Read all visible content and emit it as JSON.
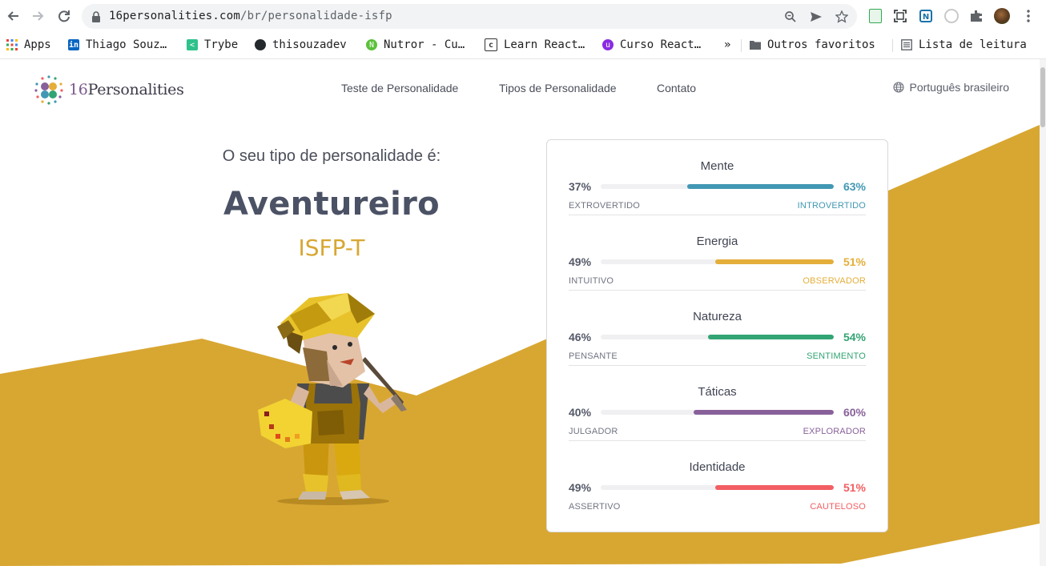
{
  "browser": {
    "url_domain": "16personalities.com",
    "url_path": "/br/personalidade-isfp"
  },
  "bookmarks": [
    {
      "label": "Apps",
      "icon": "apps-grid-icon"
    },
    {
      "label": "Thiago Souz…",
      "icon": "linkedin-icon"
    },
    {
      "label": "Trybe",
      "icon": "trybe-icon"
    },
    {
      "label": "thisouzadev",
      "icon": "github-icon"
    },
    {
      "label": "Nutror - Cu…",
      "icon": "nutror-icon"
    },
    {
      "label": "Learn React…",
      "icon": "learn-react-icon"
    },
    {
      "label": "Curso React…",
      "icon": "curso-react-icon"
    }
  ],
  "bookmarks_more": "»",
  "other_bookmarks": "Outros favoritos",
  "reading_list": "Lista de leitura",
  "site": {
    "logo_num": "16",
    "logo_text": "Personalities",
    "nav": [
      "Teste de Personalidade",
      "Tipos de Personalidade",
      "Contato"
    ],
    "language": "Português brasileiro"
  },
  "result": {
    "intro": "O seu tipo de personalidade é:",
    "name": "Aventureiro",
    "code": "ISFP-T"
  },
  "colors": {
    "accent_gold": "#d8a732",
    "mind": "#4298b4",
    "energy": "#e4ae3a",
    "nature": "#33a474",
    "tactics": "#88619a",
    "identity": "#f25e62"
  },
  "traits": [
    {
      "title": "Mente",
      "left_pct": "37%",
      "right_pct": "63%",
      "right_value": 63,
      "left_label": "EXTROVERTIDO",
      "right_label": "INTROVERTIDO",
      "color": "#4298b4"
    },
    {
      "title": "Energia",
      "left_pct": "49%",
      "right_pct": "51%",
      "right_value": 51,
      "left_label": "INTUITIVO",
      "right_label": "OBSERVADOR",
      "color": "#e4ae3a"
    },
    {
      "title": "Natureza",
      "left_pct": "46%",
      "right_pct": "54%",
      "right_value": 54,
      "left_label": "PENSANTE",
      "right_label": "SENTIMENTO",
      "color": "#33a474"
    },
    {
      "title": "Táticas",
      "left_pct": "40%",
      "right_pct": "60%",
      "right_value": 60,
      "left_label": "JULGADOR",
      "right_label": "EXPLORADOR",
      "color": "#88619a"
    },
    {
      "title": "Identidade",
      "left_pct": "49%",
      "right_pct": "51%",
      "right_value": 51,
      "left_label": "ASSERTIVO",
      "right_label": "CAUTELOSO",
      "color": "#f25e62"
    }
  ]
}
